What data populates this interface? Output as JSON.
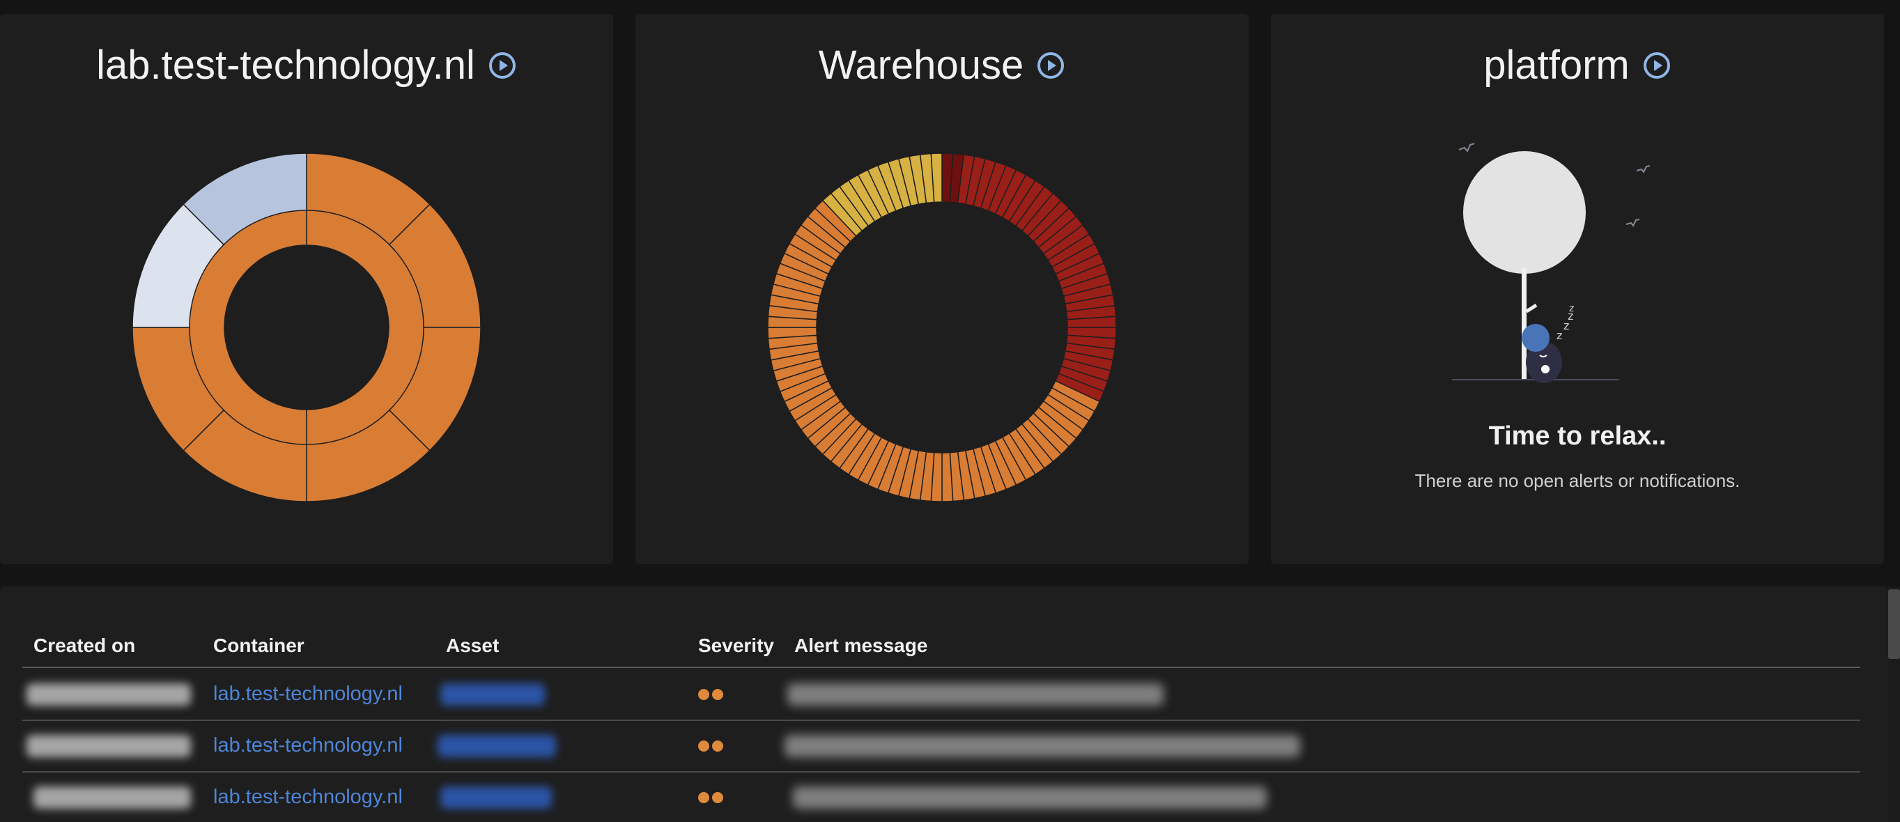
{
  "colors": {
    "orange": "#d97d35",
    "red": "#9a1f18",
    "dark_red": "#6e1010",
    "yellow": "#d7b242",
    "light_blue": "#b7c4de",
    "pale_blue": "#dde3ee",
    "link": "#4e86d8",
    "play_icon": "#8fb6e6"
  },
  "panels": [
    {
      "title": "lab.test-technology.nl",
      "icon": "play-circle-icon",
      "chart": {
        "type": "sunburst-donut",
        "outer_ring_segments": 8,
        "outer_ring_colors": [
          "orange",
          "orange",
          "orange",
          "orange",
          "orange",
          "orange",
          "pale_blue",
          "light_blue"
        ],
        "inner_ring_segments": 2,
        "inner_ring_colors": [
          "orange",
          "orange"
        ]
      }
    },
    {
      "title": "Warehouse",
      "icon": "play-circle-icon",
      "chart": {
        "type": "segmented-donut",
        "total_segments": 100,
        "groups": [
          {
            "severity": "dark_red",
            "count": 2
          },
          {
            "severity": "red",
            "count": 30
          },
          {
            "severity": "orange",
            "count": 56
          },
          {
            "severity": "yellow",
            "count": 12
          }
        ]
      }
    },
    {
      "title": "platform",
      "icon": "play-circle-icon",
      "empty_state": {
        "title": "Time to relax..",
        "message": "There are no open alerts or notifications."
      }
    }
  ],
  "table": {
    "columns": [
      "Created on",
      "Container",
      "Asset",
      "Severity",
      "Alert message"
    ],
    "rows": [
      {
        "container": "lab.test-technology.nl",
        "severity_dots": 2
      },
      {
        "container": "lab.test-technology.nl",
        "severity_dots": 2
      },
      {
        "container": "lab.test-technology.nl",
        "severity_dots": 2
      }
    ]
  }
}
